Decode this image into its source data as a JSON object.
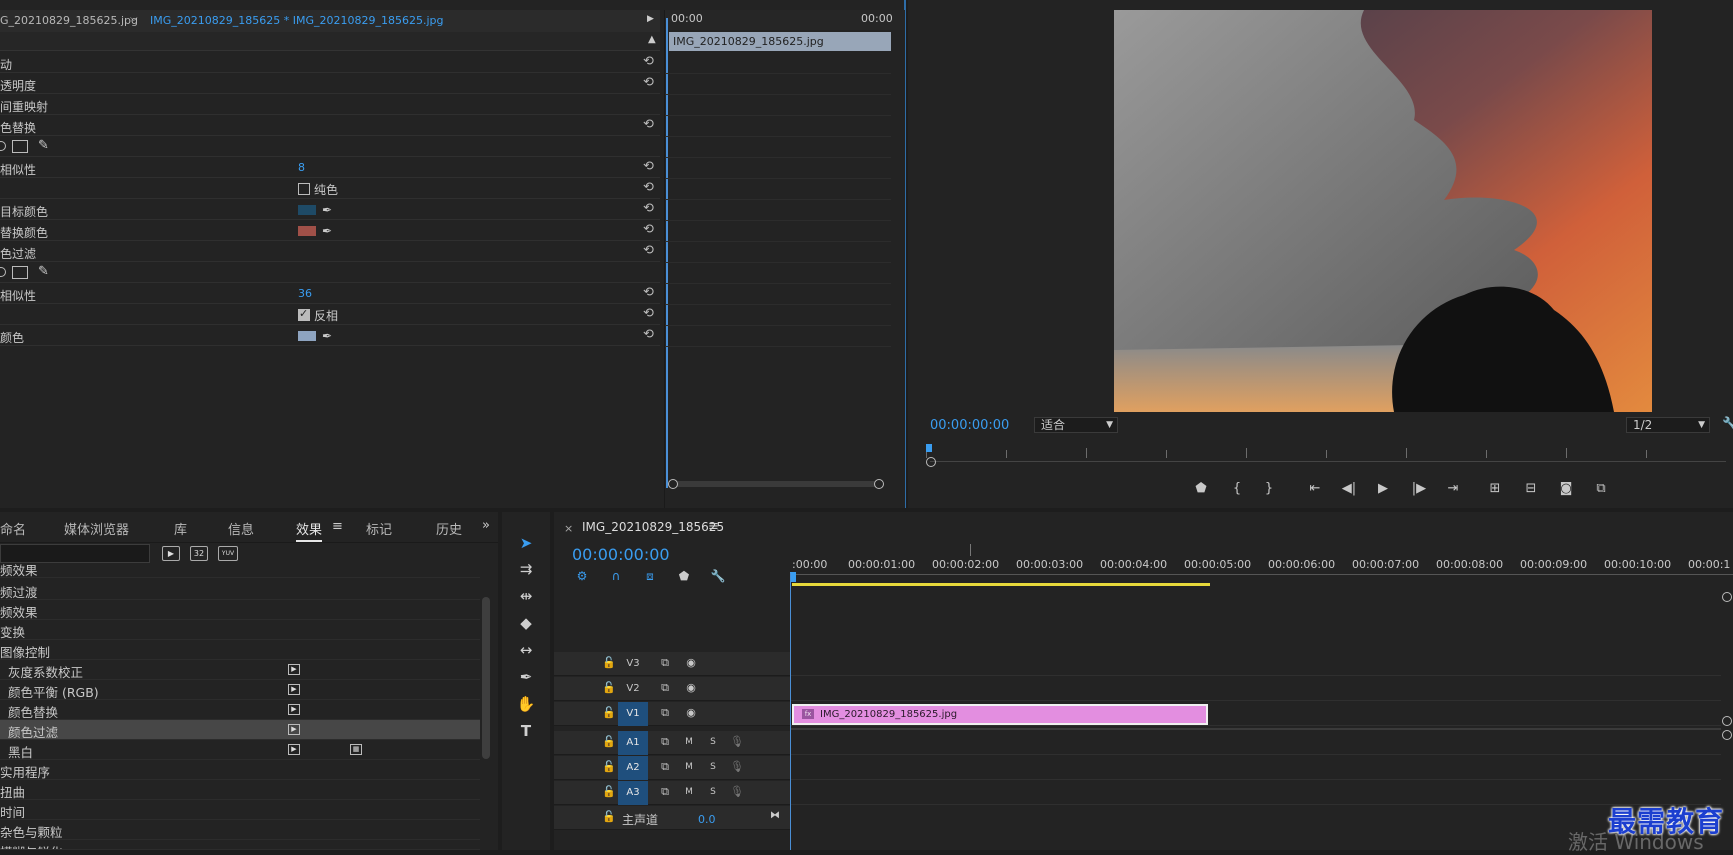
{
  "effect_controls": {
    "tab_source": "G_20210829_185625.jpg",
    "tab_active": "IMG_20210829_185625 * IMG_20210829_185625.jpg",
    "mini_timeline": {
      "time_start": "00:00",
      "time_end": "00:00",
      "clip": "IMG_20210829_185625.jpg"
    },
    "rows": [
      {
        "label": "动"
      },
      {
        "label": "透明度"
      },
      {
        "label": "间重映射"
      },
      {
        "label": "色替换"
      },
      {
        "label": ""
      },
      {
        "label": "相似性",
        "value": "8"
      },
      {
        "label": "",
        "checkbox": "纯色"
      },
      {
        "label": "目标颜色"
      },
      {
        "label": "替换颜色"
      },
      {
        "label": "色过滤"
      },
      {
        "label": ""
      },
      {
        "label": "相似性",
        "value": "36"
      },
      {
        "label": "",
        "checkbox": "反相"
      },
      {
        "label": "颜色"
      }
    ],
    "colors": {
      "target": "#1e4a66",
      "replace": "#a05048",
      "filter": "#8ea4c0"
    }
  },
  "program_monitor": {
    "timecode": "00:00:00:00",
    "fit": "适合",
    "resolution": "1/2"
  },
  "effects_panel": {
    "tabs": [
      "命名",
      "媒体浏览器",
      "库",
      "信息",
      "效果",
      "标记",
      "历史"
    ],
    "active_tab": "效果",
    "items": [
      {
        "text": "频效果"
      },
      {
        "text": "频过渡"
      },
      {
        "text": "频效果"
      },
      {
        "text": "变换"
      },
      {
        "text": "图像控制"
      },
      {
        "text": "灰度系数校正"
      },
      {
        "text": "颜色平衡 (RGB)"
      },
      {
        "text": "颜色替换"
      },
      {
        "text": "颜色过滤"
      },
      {
        "text": "黑白"
      },
      {
        "text": "实用程序"
      },
      {
        "text": "扭曲"
      },
      {
        "text": "时间"
      },
      {
        "text": "杂色与颗粒"
      },
      {
        "text": "模糊与锐化"
      }
    ],
    "badges": [
      "32",
      "YUV"
    ]
  },
  "timeline": {
    "sequence_name": "IMG_20210829_185625",
    "timecode": "00:00:00:00",
    "ruler_labels": [
      ":00:00",
      "00:00:01:00",
      "00:00:02:00",
      "00:00:03:00",
      "00:00:04:00",
      "00:00:05:00",
      "00:00:06:00",
      "00:00:07:00",
      "00:00:08:00",
      "00:00:09:00",
      "00:00:10:00",
      "00:00:1"
    ],
    "tracks": {
      "video": [
        "V3",
        "V2",
        "V1"
      ],
      "audio": [
        "A1",
        "A2",
        "A3"
      ],
      "mute": "M",
      "solo": "S",
      "master": "主声道",
      "master_value": "0.0"
    },
    "clip": "IMG_20210829_185625.jpg",
    "clip_fx": "fx"
  },
  "overlay": {
    "windows_watermark": "激活 Windows",
    "brand": "最需教育"
  }
}
